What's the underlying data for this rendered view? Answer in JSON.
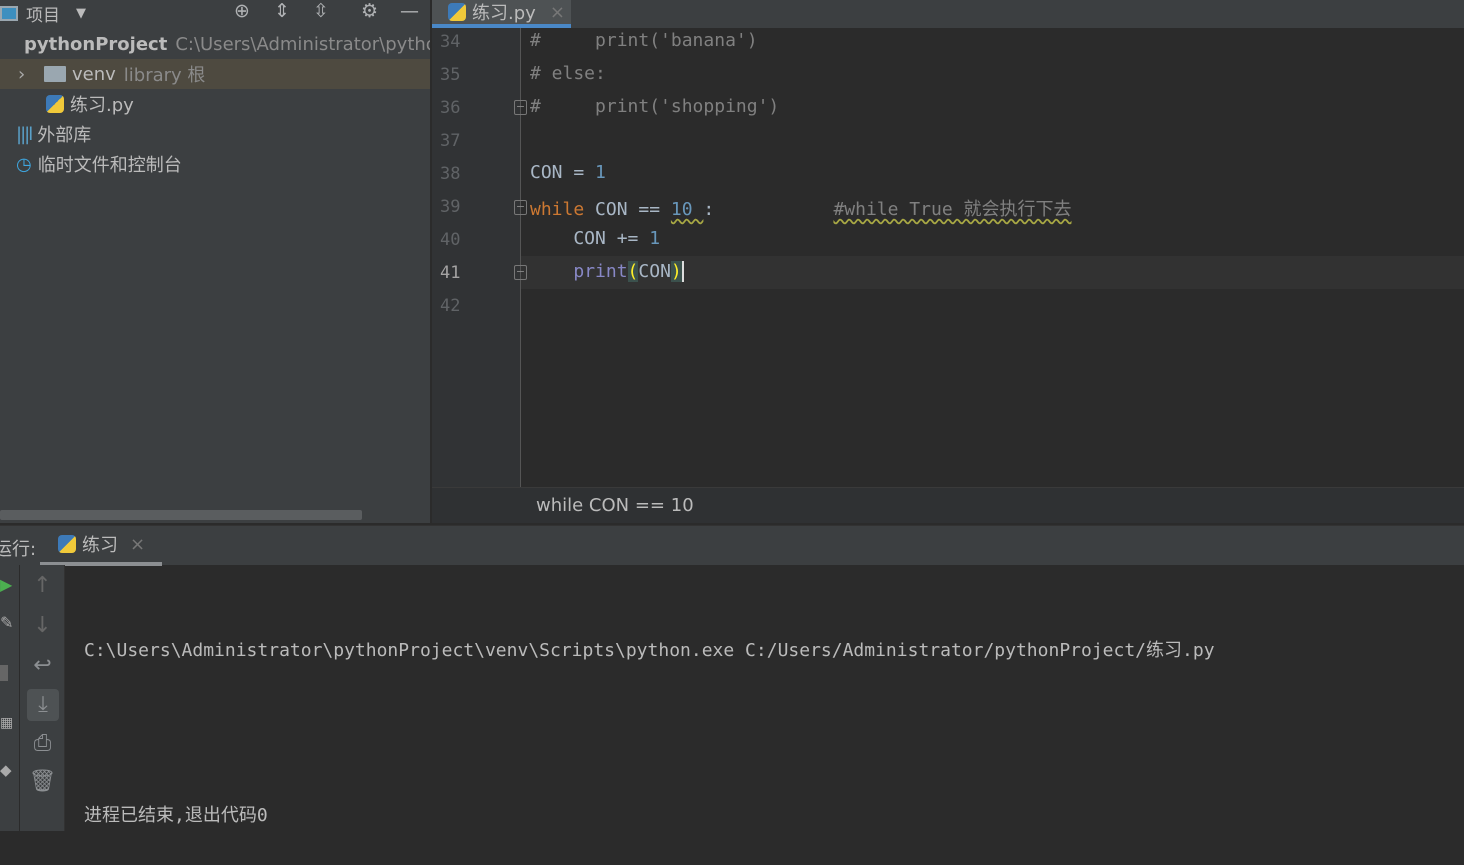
{
  "project_panel": {
    "title": "项目",
    "root_name": "pythonProject",
    "root_path": "C:\\Users\\Administrator\\pythonProject",
    "venv": "venv",
    "venv_tag": "library 根",
    "file": "练习.py",
    "external": "外部库",
    "scratch": "临时文件和控制台"
  },
  "editor": {
    "tab": "练习.py",
    "current_line": "41",
    "lines": [
      {
        "no": "34",
        "tokens": [
          {
            "t": "#     print('banana')",
            "c": "c"
          }
        ]
      },
      {
        "no": "35",
        "tokens": [
          {
            "t": "# else:",
            "c": "c"
          }
        ]
      },
      {
        "no": "36",
        "tokens": [
          {
            "t": "#     print('shopping')",
            "c": "c"
          }
        ]
      },
      {
        "no": "37",
        "tokens": []
      },
      {
        "no": "38",
        "tokens": [
          {
            "t": "CON = ",
            "c": ""
          },
          {
            "t": "1",
            "c": "n"
          }
        ]
      },
      {
        "no": "39",
        "tokens": [
          {
            "t": "while",
            "c": "k"
          },
          {
            "t": " CON == ",
            "c": ""
          },
          {
            "t": "10 ",
            "c": "n wavy"
          },
          {
            "t": ":           ",
            "c": ""
          },
          {
            "t": "#while True 就会执行下去",
            "c": "c wavy"
          }
        ]
      },
      {
        "no": "40",
        "tokens": [
          {
            "t": "    CON += ",
            "c": ""
          },
          {
            "t": "1",
            "c": "n"
          }
        ]
      },
      {
        "no": "41",
        "tokens": [
          {
            "t": "    ",
            "c": ""
          },
          {
            "t": "print",
            "c": "f"
          },
          {
            "t": "(",
            "c": "p"
          },
          {
            "t": "CON",
            "c": ""
          },
          {
            "t": ")",
            "c": "p"
          }
        ]
      },
      {
        "no": "42",
        "tokens": []
      }
    ],
    "breadcrumb": "while CON == 10"
  },
  "run_panel": {
    "label": "运行:",
    "tab": "练习",
    "output": [
      "C:\\Users\\Administrator\\pythonProject\\venv\\Scripts\\python.exe C:/Users/Administrator/pythonProject/练习.py",
      "",
      "进程已结束,退出代码0"
    ]
  },
  "colors": {
    "accent": "#4a88c7",
    "keyword": "#cc7832",
    "number": "#6897bb",
    "comment": "#808080",
    "builtin": "#8888c6"
  }
}
